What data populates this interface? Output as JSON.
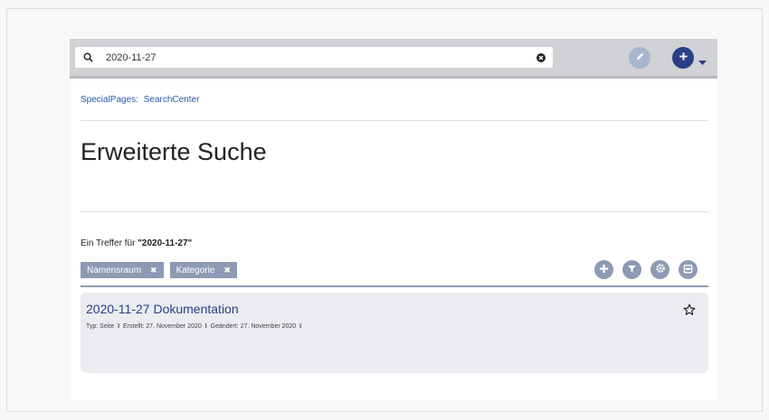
{
  "search": {
    "value": "2020-11-27",
    "placeholder": ""
  },
  "breadcrumb": {
    "part1": "SpecialPages:",
    "part2": "SearchCenter"
  },
  "page": {
    "title": "Erweiterte Suche"
  },
  "results": {
    "count_prefix": "Ein Treffer für",
    "count_query": "\"2020-11-27\""
  },
  "filters": [
    {
      "label": "Namensraum",
      "remove": "✖"
    },
    {
      "label": "Kategorie",
      "remove": "✖"
    }
  ],
  "tools": [
    "plus-icon",
    "filter-icon",
    "gear-icon",
    "export-icon"
  ],
  "result": {
    "title": "2020-11-27 Dokumentation",
    "type": "Typ: Seite",
    "created": "Erstellt: 27. November 2020",
    "modified": "Geändert: 27. November 2020",
    "sep": "I"
  },
  "colors": {
    "accent": "#2a3f86",
    "chip": "#8e9ab4",
    "link": "#2a58ad",
    "topbar": "#d0d2d5",
    "card": "#eaecf0"
  }
}
